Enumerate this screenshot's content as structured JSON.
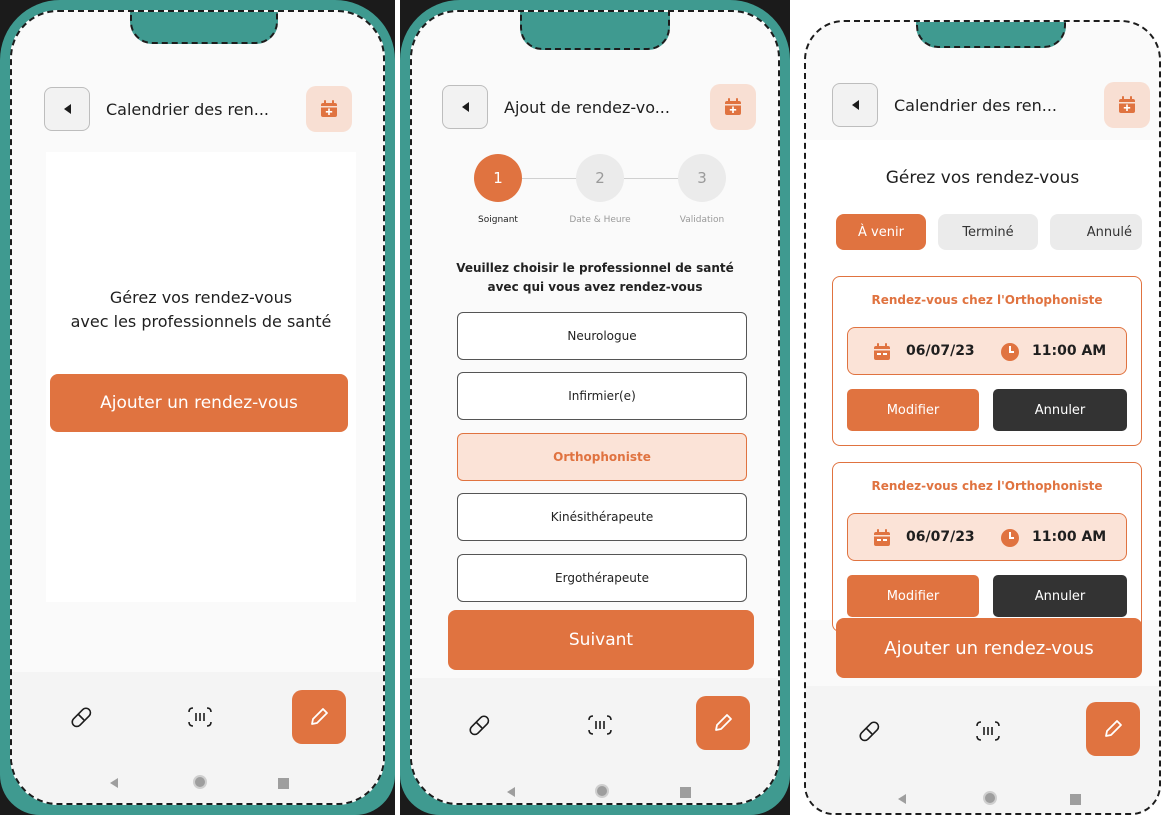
{
  "screen1": {
    "header_title": "Calendrier des ren...",
    "message_line1": "Gérez vos rendez-vous",
    "message_line2": "avec les professionnels de santé",
    "add_button": "Ajouter un rendez-vous"
  },
  "screen2": {
    "header_title": "Ajout de rendez-vo...",
    "steps": [
      {
        "number": "1",
        "label": "Soignant"
      },
      {
        "number": "2",
        "label": "Date & Heure"
      },
      {
        "number": "3",
        "label": "Validation"
      }
    ],
    "prompt_line1": "Veuillez choisir le professionnel de santé",
    "prompt_line2": "avec qui vous avez rendez-vous",
    "options": [
      "Neurologue",
      "Infirmier(e)",
      "Orthophoniste",
      "Kinésithérapeute",
      "Ergothérapeute"
    ],
    "selected_option": "Orthophoniste",
    "next_button": "Suivant"
  },
  "screen3": {
    "header_title": "Calendrier des ren...",
    "subtitle": "Gérez vos rendez-vous",
    "tabs": [
      "À venir",
      "Terminé",
      "Annulé"
    ],
    "active_tab": "À venir",
    "appointments": [
      {
        "title": "Rendez-vous chez l'Orthophoniste",
        "date": "06/07/23",
        "time": "11:00 AM",
        "modify": "Modifier",
        "cancel": "Annuler"
      },
      {
        "title": "Rendez-vous chez l'Orthophoniste",
        "date": "06/07/23",
        "time": "11:00 AM",
        "modify": "Modifier",
        "cancel": "Annuler"
      }
    ],
    "add_button": "Ajouter un rendez-vous"
  },
  "icons": {
    "back": "back-arrow-icon",
    "calendar": "calendar-add-icon",
    "nav_pill": "pill-icon",
    "nav_scan": "scan-icon",
    "nav_edit": "pencil-icon"
  },
  "colors": {
    "accent": "#e07340",
    "accent_light": "#fbe3d7",
    "frame": "#3f9a90",
    "dark_button": "#333333"
  }
}
